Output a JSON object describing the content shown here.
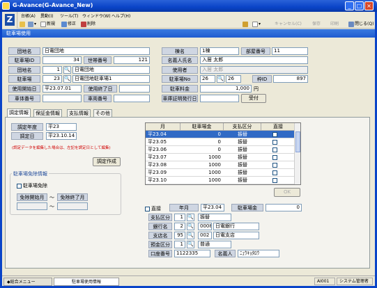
{
  "window": {
    "title": "G-Avance(G-Avance_New)",
    "min": "_",
    "max": "□",
    "close": "×"
  },
  "menu": [
    "台帳(A)",
    "異動(I)",
    "ツール(T)",
    "ウィンドウ(W)",
    "ヘルプ(H)"
  ],
  "toolbar": {
    "new": "新規",
    "edit": "修正",
    "delete": "削除",
    "cancel": "キャンセル(C)",
    "save": "保存",
    "print": "印刷",
    "close": "閉じる(Q)"
  },
  "logo": "Z",
  "banner": "駐車場使用",
  "form": {
    "estate_label": "団地名",
    "estate_value": "日電団地",
    "building_label": "棟名",
    "building_value": "1棟",
    "room_label": "部屋番号",
    "room_value": "11",
    "parking_id_label": "駐車場ID",
    "parking_id_value": "34",
    "household_label": "世帯番号",
    "household_value": "121",
    "tenant_label": "名義人氏名",
    "tenant_value": "入居 太郎",
    "estate2_label": "団地名",
    "estate2_code": "1",
    "estate2_name": "日電団地",
    "user_label": "使用者",
    "user_value": "入居 太郎",
    "lot_label": "駐車場",
    "lot_code": "23",
    "lot_name": "日電団地駐車場1",
    "lotno_label": "駐車場No",
    "lotno_a": "26",
    "lotno_b": "26",
    "frame_label": "枠ID",
    "frame_value": "897",
    "start_label": "使用開始日",
    "start_value": "平23.07.01",
    "end_label": "使用終了日",
    "end_value": "",
    "fee_label": "駐車料金",
    "fee_value": "1,000",
    "fee_unit": "円",
    "car_label": "車体番号",
    "car_value": "",
    "vehicle_label": "車両番号",
    "vehicle_value": "",
    "cert_label": "車庫証明発行日",
    "cert_value": "",
    "receive_btn": "受付"
  },
  "tabs": [
    "調定情報",
    "保証金情報",
    "支払情報",
    "その他"
  ],
  "adjust": {
    "year_label": "調定年度",
    "year_value": "平23",
    "date_label": "調定日",
    "date_value": "平23.10.14",
    "notice": "(調定データを編集した場合は、左記を調定日として編集)",
    "create_btn": "調定作成"
  },
  "exempt": {
    "title": "駐車場免除情報",
    "check_label": "駐車場免除",
    "start_label": "免除開始月",
    "tilde": "〜",
    "end_label": "免除終了月",
    "start_value": "",
    "end_value": ""
  },
  "grid": {
    "headers": [
      "月",
      "駐車場金",
      "支払区分",
      "直接"
    ],
    "rows": [
      {
        "month": "平23.04",
        "amount": "0",
        "pay": "振替"
      },
      {
        "month": "平23.05",
        "amount": "0",
        "pay": "振替"
      },
      {
        "month": "平23.06",
        "amount": "0",
        "pay": "振替"
      },
      {
        "month": "平23.07",
        "amount": "1000",
        "pay": "振替"
      },
      {
        "month": "平23.08",
        "amount": "1000",
        "pay": "振替"
      },
      {
        "month": "平23.09",
        "amount": "1000",
        "pay": "振替"
      },
      {
        "month": "平23.10",
        "amount": "1000",
        "pay": "振替"
      }
    ],
    "ok_btn": "OK"
  },
  "detail": {
    "direct_label": "直接",
    "ym_label": "年月",
    "ym_value": "平23.04",
    "fee_label": "駐車場金",
    "fee_value": "0",
    "pay_label": "支払区分",
    "pay_code": "1",
    "pay_value": "振替",
    "bank_label": "銀行名",
    "bank_code": "2",
    "bank_no": "0008",
    "bank_name": "日電銀行",
    "branch_label": "支店名",
    "branch_code": "95",
    "branch_no": "002",
    "branch_name": "日電支店",
    "acct_type_label": "預金区分",
    "acct_type_code": "1",
    "acct_type_value": "普通",
    "acct_no_label": "口座番号",
    "acct_no_value": "1122335",
    "holder_label": "名義人",
    "holder_value": "ﾆｭｳｷｮﾀﾛｳ"
  },
  "statusbar": {
    "tab1": "◆総合メニュー",
    "tab2": "駐車場使用情報",
    "code": "AI001",
    "user": "システム管理者"
  }
}
